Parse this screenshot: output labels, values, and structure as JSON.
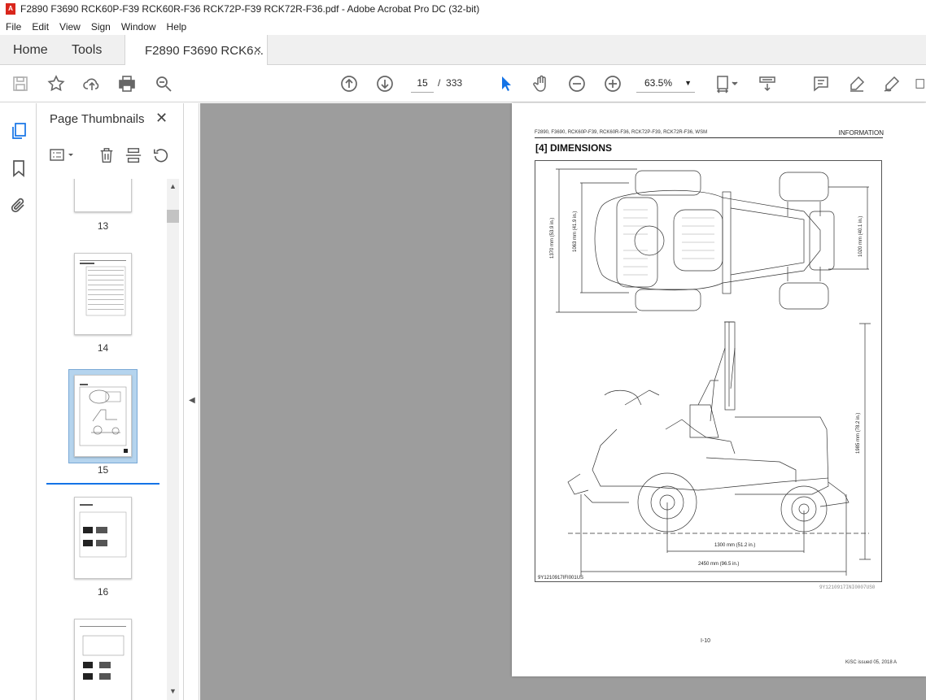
{
  "window": {
    "title": "F2890 F3690 RCK60P-F39 RCK60R-F36 RCK72P-F39 RCK72R-F36.pdf - Adobe Acrobat Pro DC (32-bit)"
  },
  "menu": [
    "File",
    "Edit",
    "View",
    "Sign",
    "Window",
    "Help"
  ],
  "tabs": {
    "home": "Home",
    "tools": "Tools",
    "doc": "F2890 F3690 RCK6..."
  },
  "toolbar": {
    "current_page": "15",
    "page_sep": "/",
    "total_pages": "333",
    "zoom": "63.5%"
  },
  "panel": {
    "title": "Page Thumbnails"
  },
  "thumbnails": [
    {
      "label": "13"
    },
    {
      "label": "14"
    },
    {
      "label": "15",
      "selected": true
    },
    {
      "label": "16"
    }
  ],
  "document": {
    "header_left": "F2890, F3690, RCK60P-F39, RCK60R-F36, RCK72P-F39, RCK72R-F36, WSM",
    "header_right": "INFORMATION",
    "section": "[4]  DIMENSIONS",
    "dim_1370": "1370 mm (53.9 in.)",
    "dim_1063": "1063 mm (41.9 in.)",
    "dim_1020": "1020 mm (40.1 in.)",
    "dim_1985": "1985 mm (78.2 in.)",
    "dim_1300": "1300 mm (51.2 in.)",
    "dim_2450": "2450 mm (96.5 in.)",
    "figure_code": "9Y1210917IFI001US",
    "figure_code_right": "9Y1210917INI0007US0",
    "page_number": "I-10",
    "footer": "KiSC issued 05, 2018 A"
  },
  "colors": {
    "accent": "#1473e6",
    "viewer_bg": "#9d9d9d",
    "pdf_red": "#d9261c"
  }
}
